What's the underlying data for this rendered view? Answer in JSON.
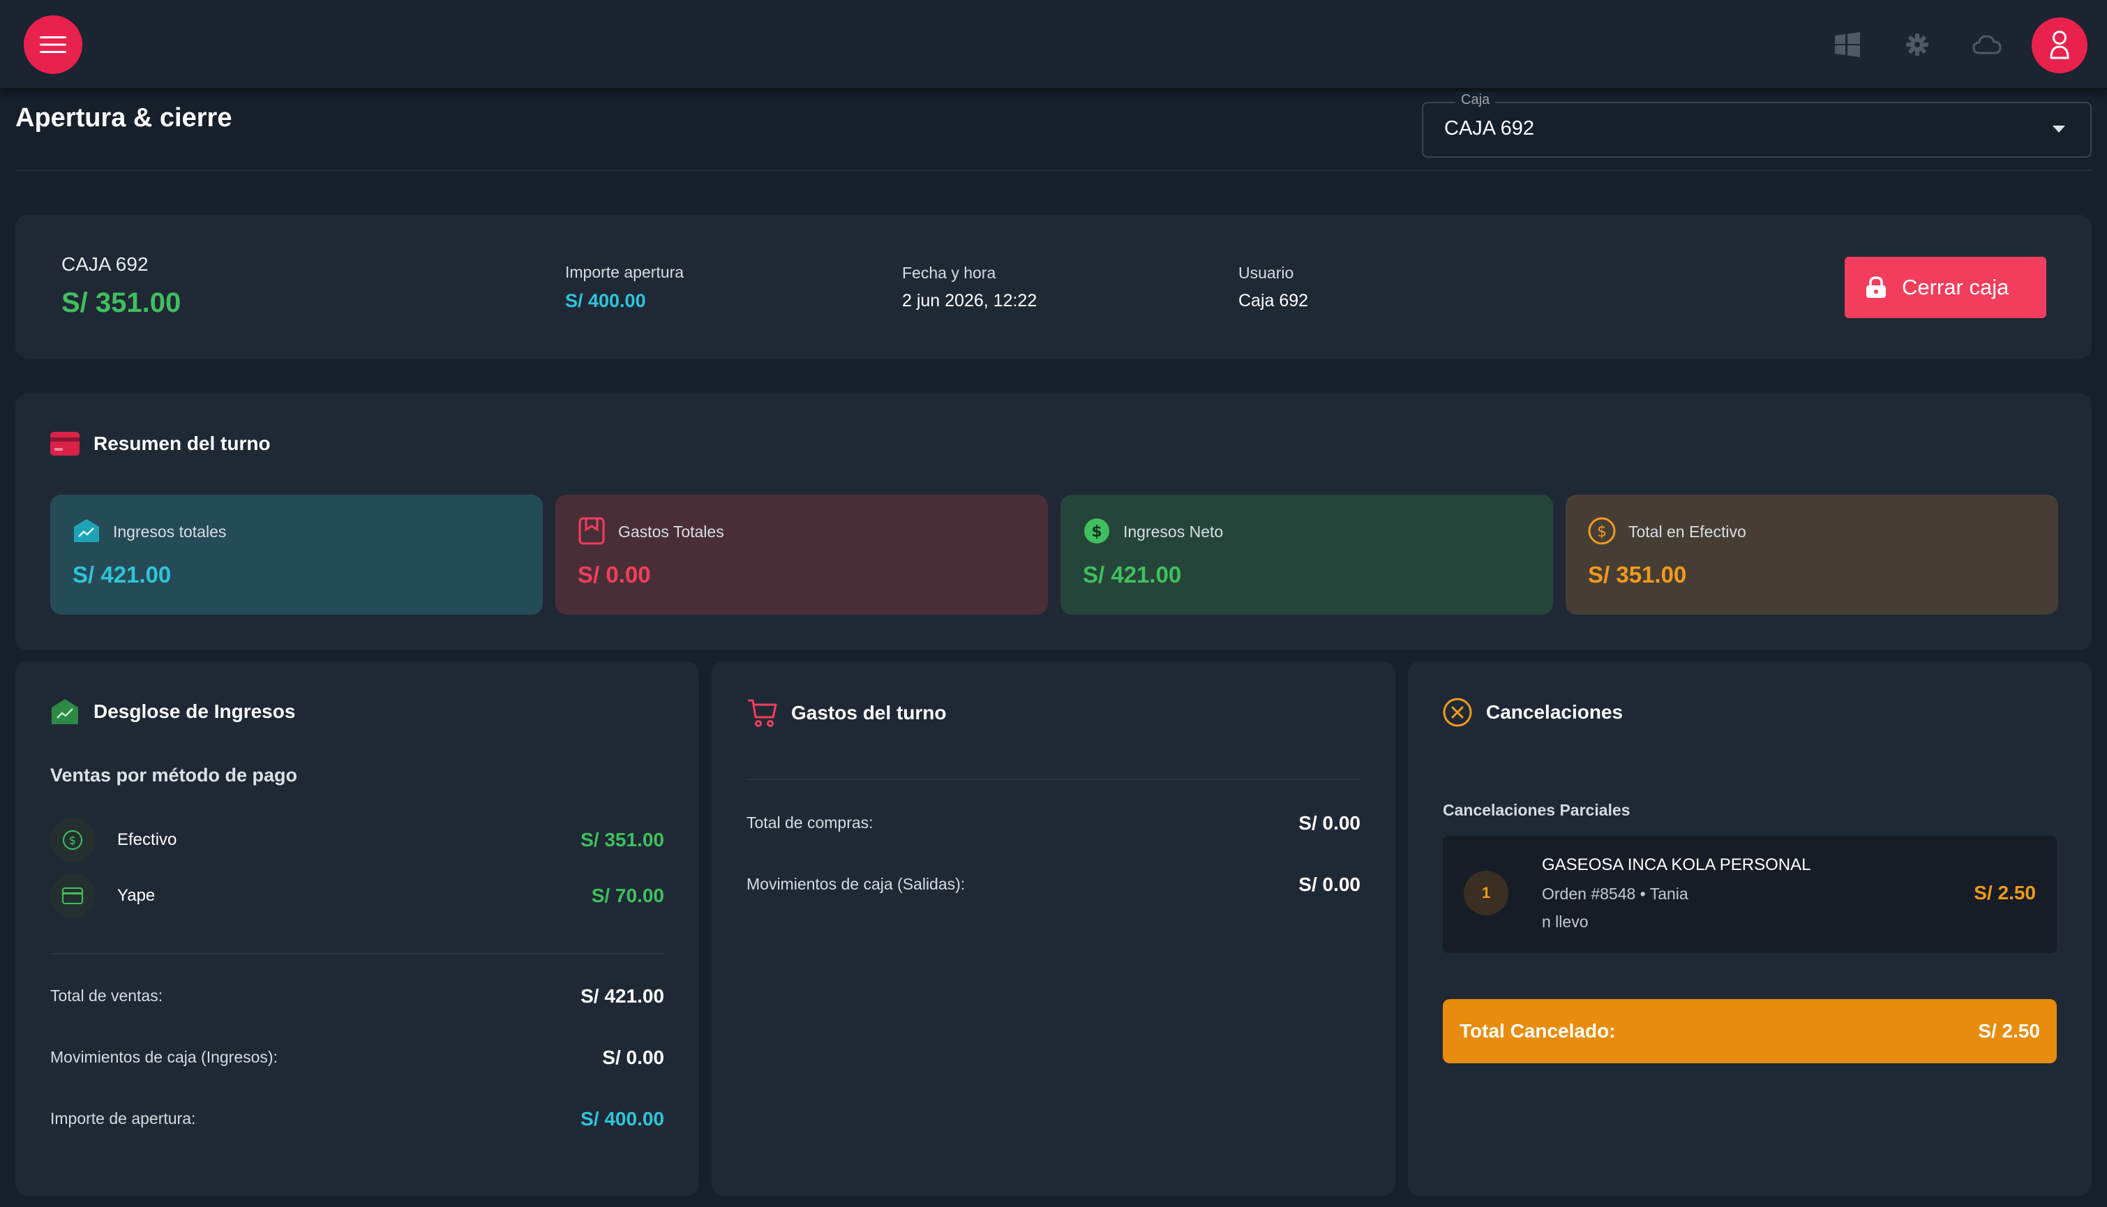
{
  "header": {
    "page_title": "Apertura & cierre",
    "caja_select": {
      "label": "Caja",
      "value": "CAJA 692"
    },
    "icons": [
      "menu-icon",
      "windows-icon",
      "settings-icon",
      "cloud-icon",
      "user-icon"
    ]
  },
  "caja_info": {
    "name": "CAJA 692",
    "balance": "S/ 351.00",
    "importe_apertura_label": "Importe apertura",
    "importe_apertura_value": "S/ 400.00",
    "fecha_label": "Fecha y hora",
    "fecha_value": "2 jun 2026, 12:22",
    "usuario_label": "Usuario",
    "usuario_value": "Caja 692",
    "close_button": "Cerrar caja"
  },
  "resumen": {
    "title": "Resumen del turno",
    "stats": [
      {
        "label": "Ingresos totales",
        "value": "S/ 421.00",
        "color": "#2fc4d9"
      },
      {
        "label": "Gastos Totales",
        "value": "S/ 0.00",
        "color": "#f23e5c"
      },
      {
        "label": "Ingresos Neto",
        "value": "S/ 421.00",
        "color": "#3fbf5e"
      },
      {
        "label": "Total en Efectivo",
        "value": "S/ 351.00",
        "color": "#f19a1d"
      }
    ]
  },
  "ingresos": {
    "title": "Desglose de Ingresos",
    "subtitle": "Ventas por método de pago",
    "methods": [
      {
        "name": "Efectivo",
        "value": "S/ 351.00"
      },
      {
        "name": "Yape",
        "value": "S/ 70.00"
      }
    ],
    "totals": [
      {
        "label": "Total de ventas:",
        "value": "S/ 421.00"
      },
      {
        "label": "Movimientos de caja (Ingresos):",
        "value": "S/ 0.00"
      },
      {
        "label": "Importe de apertura:",
        "value": "S/ 400.00"
      }
    ]
  },
  "gastos": {
    "title": "Gastos del turno",
    "rows": [
      {
        "label": "Total de compras:",
        "value": "S/ 0.00"
      },
      {
        "label": "Movimientos de caja (Salidas):",
        "value": "S/ 0.00"
      }
    ]
  },
  "cancelaciones": {
    "title": "Cancelaciones",
    "subtitle": "Cancelaciones Parciales",
    "items": [
      {
        "qty": "1",
        "product": "GASEOSA INCA KOLA PERSONAL",
        "order": "Orden #8548 • Tania",
        "note": "n llevo",
        "amount": "S/ 2.50"
      }
    ],
    "total_label": "Total Cancelado:",
    "total_value": "S/ 2.50"
  },
  "colors": {
    "accent": "#e9214d",
    "green": "#3fbf5e",
    "cyan": "#2fc4d9",
    "red": "#f23e5c",
    "orange": "#f19a1d",
    "total_cancelado_bg": "#e88c0d"
  }
}
